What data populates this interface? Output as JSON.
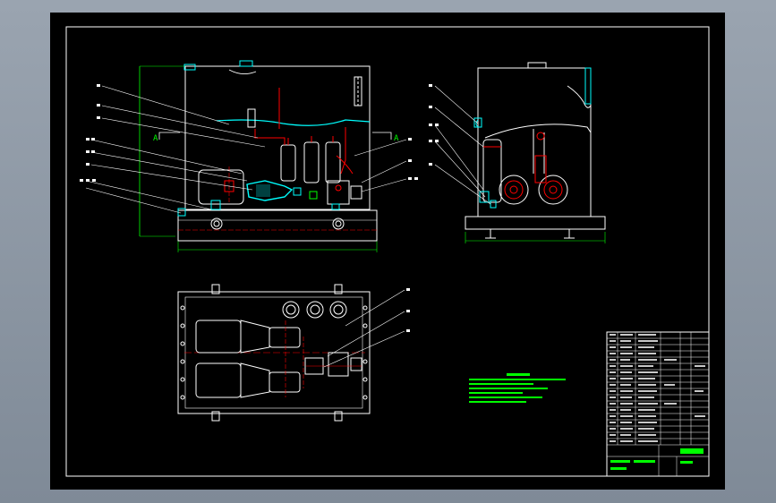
{
  "app": {
    "title": "",
    "background_color": "#8e98a4",
    "sheet_color": "#000000"
  },
  "drawing": {
    "section_marker_left": "A",
    "section_marker_right": "A",
    "colors": {
      "outline": "#ffffff",
      "cyan": "#00ffff",
      "red": "#ff0000",
      "green": "#00ff00",
      "yellow": "#ffff00"
    },
    "views": [
      "front-view",
      "side-view",
      "top-view"
    ],
    "notes_panel": "technical-requirements",
    "title_block": "title-block"
  }
}
